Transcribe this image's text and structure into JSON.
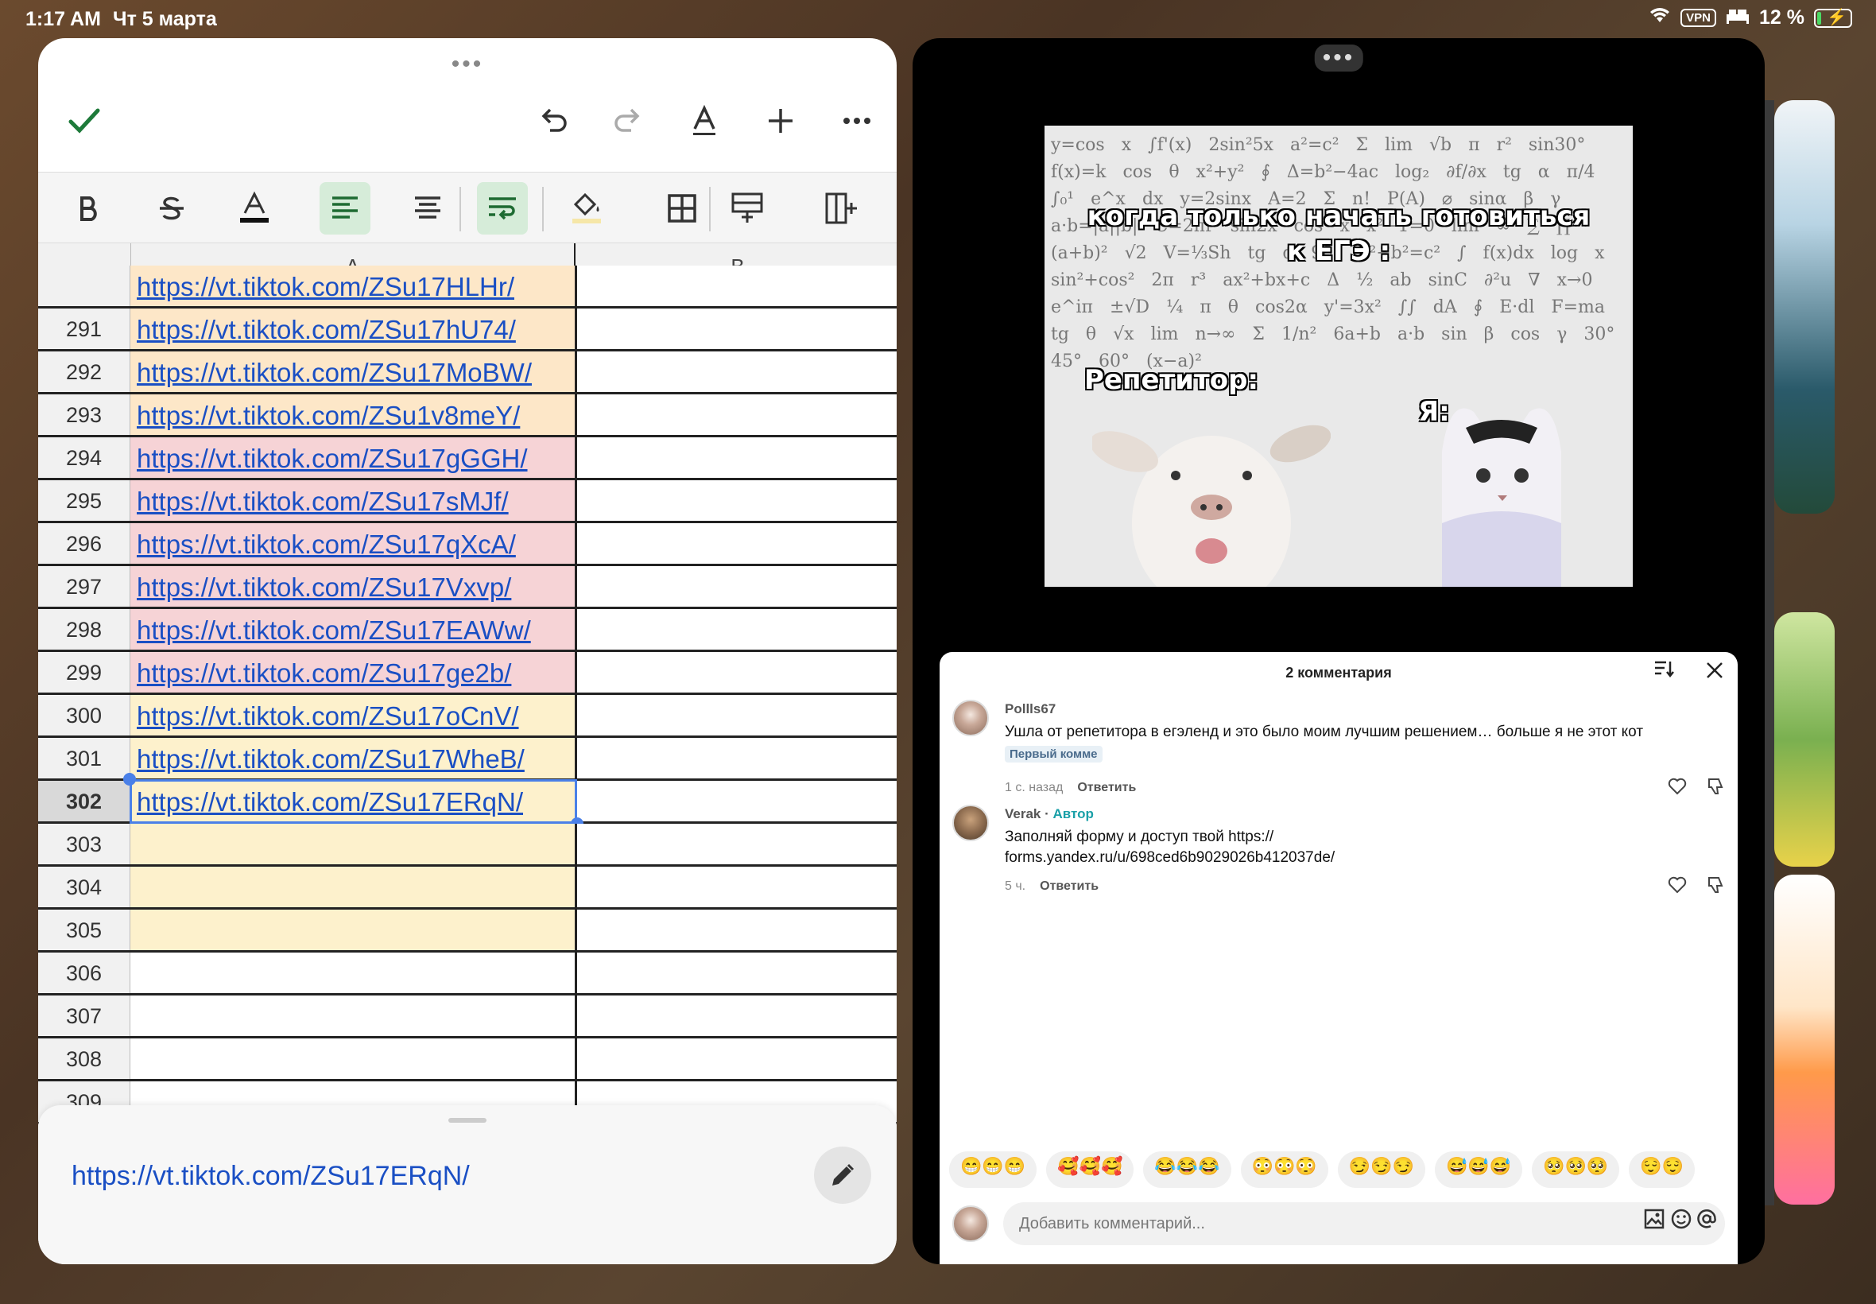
{
  "status": {
    "time": "1:17 AM",
    "date": "Чт 5 марта",
    "vpn": "VPN",
    "battery": "12 %"
  },
  "sheet": {
    "columns": [
      "A",
      "B"
    ],
    "partial_top_row": "https://vt.tiktok.com/ZSu17HLHr/",
    "rows": [
      {
        "num": "291",
        "a": "https://vt.tiktok.com/ZSu17hU74/",
        "color": "#fde7c8"
      },
      {
        "num": "292",
        "a": "https://vt.tiktok.com/ZSu17MoBW/",
        "color": "#fde7c8"
      },
      {
        "num": "293",
        "a": "https://vt.tiktok.com/ZSu1v8meY/",
        "color": "#fde7c8"
      },
      {
        "num": "294",
        "a": "https://vt.tiktok.com/ZSu17gGGH/",
        "color": "#f6d3d6"
      },
      {
        "num": "295",
        "a": "https://vt.tiktok.com/ZSu17sMJf/",
        "color": "#f6d3d6"
      },
      {
        "num": "296",
        "a": "https://vt.tiktok.com/ZSu17qXcA/",
        "color": "#f6d3d6"
      },
      {
        "num": "297",
        "a": "https://vt.tiktok.com/ZSu17Vxvp/",
        "color": "#f6d3d6"
      },
      {
        "num": "298",
        "a": "https://vt.tiktok.com/ZSu17EAWw/",
        "color": "#f6d3d6"
      },
      {
        "num": "299",
        "a": "https://vt.tiktok.com/ZSu17ge2b/",
        "color": "#f6d3d6"
      },
      {
        "num": "300",
        "a": "https://vt.tiktok.com/ZSu17oCnV/",
        "color": "#fdf1cc"
      },
      {
        "num": "301",
        "a": "https://vt.tiktok.com/ZSu17WheB/",
        "color": "#fdf1cc"
      },
      {
        "num": "302",
        "a": "https://vt.tiktok.com/ZSu17ERqN/",
        "color": "#fdf1cc"
      },
      {
        "num": "303",
        "a": "",
        "color": "#fdf1cc"
      },
      {
        "num": "304",
        "a": "",
        "color": "#fdf1cc"
      },
      {
        "num": "305",
        "a": "",
        "color": "#fdf1cc"
      },
      {
        "num": "306",
        "a": "",
        "color": "#ffffff"
      },
      {
        "num": "307",
        "a": "",
        "color": "#ffffff"
      },
      {
        "num": "308",
        "a": "",
        "color": "#ffffff"
      },
      {
        "num": "309",
        "a": "",
        "color": "#ffffff"
      }
    ],
    "selected_row": "302",
    "edit_value": "https://vt.tiktok.com/ZSu17ERqN/"
  },
  "meme": {
    "caption_top": "когда только начать готовиться\nк ЕГЭ :",
    "caption_left": "Репетитор:",
    "caption_right": "Я:"
  },
  "comments": {
    "header": "2 комментария",
    "items": [
      {
        "user": "Pollls67",
        "author_tag": "",
        "text": "Ушла от репетитора в егэленд и это было моим лучшим решением… больше я не этот кот",
        "badge": "Первый комме",
        "time": "1 с. назад",
        "reply": "Ответить"
      },
      {
        "user": "Verak",
        "author_tag": "Автор",
        "text": "Заполняй форму и доступ твой https://\nforms.yandex.ru/u/698ced6b9029026b412037de/",
        "badge": "",
        "time": "5 ч.",
        "reply": "Ответить"
      }
    ],
    "emoji_rows": [
      "😁😁😁",
      "🥰🥰🥰",
      "😂😂😂",
      "😳😳😳",
      "😏😏😏",
      "😅😅😅",
      "🥺🥺🥺",
      "😌😌"
    ],
    "placeholder": "Добавить комментарий..."
  }
}
